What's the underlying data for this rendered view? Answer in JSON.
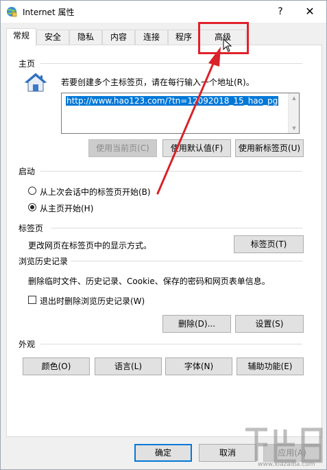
{
  "window": {
    "title": "Internet 属性",
    "help_glyph": "?",
    "close_glyph": "✕"
  },
  "tabs": [
    {
      "label": "常规",
      "active": true
    },
    {
      "label": "安全",
      "active": false
    },
    {
      "label": "隐私",
      "active": false
    },
    {
      "label": "内容",
      "active": false
    },
    {
      "label": "连接",
      "active": false
    },
    {
      "label": "程序",
      "active": false
    },
    {
      "label": "高级",
      "active": false
    }
  ],
  "homepage": {
    "section_label": "主页",
    "icon": "house-icon",
    "instruction": "若要创建多个主标签页，请在每行输入一个地址(R)。",
    "url_value": "http://www.hao123.com/?tn=12092018_15_hao_pg",
    "buttons": {
      "use_current": "使用当前页(C)",
      "use_default": "使用默认值(F)",
      "use_new_tab": "使用新标签页(U)"
    }
  },
  "startup": {
    "section_label": "启动",
    "options": [
      {
        "label": "从上次会话中的标签页开始(B)",
        "checked": false
      },
      {
        "label": "从主页开始(H)",
        "checked": true
      }
    ]
  },
  "tabs_section": {
    "section_label": "标签页",
    "description": "更改网页在标签页中的显示方式。",
    "button": "标签页(T)"
  },
  "history": {
    "section_label": "浏览历史记录",
    "description": "删除临时文件、历史记录、Cookie、保存的密码和网页表单信息。",
    "checkbox_label": "退出时删除浏览历史记录(W)",
    "checkbox_checked": false,
    "delete_button": "删除(D)...",
    "settings_button": "设置(S)"
  },
  "appearance": {
    "section_label": "外观",
    "buttons": [
      "颜色(O)",
      "语言(L)",
      "字体(N)",
      "辅助功能(E)"
    ]
  },
  "footer": {
    "ok": "确定",
    "cancel": "取消",
    "apply": "应用(A)"
  },
  "watermark": {
    "url": "www.xiazaiba.com"
  },
  "colors": {
    "accent": "#0078d7",
    "highlight_box": "#e0202a",
    "annotation_arrow": "#d9222a"
  }
}
